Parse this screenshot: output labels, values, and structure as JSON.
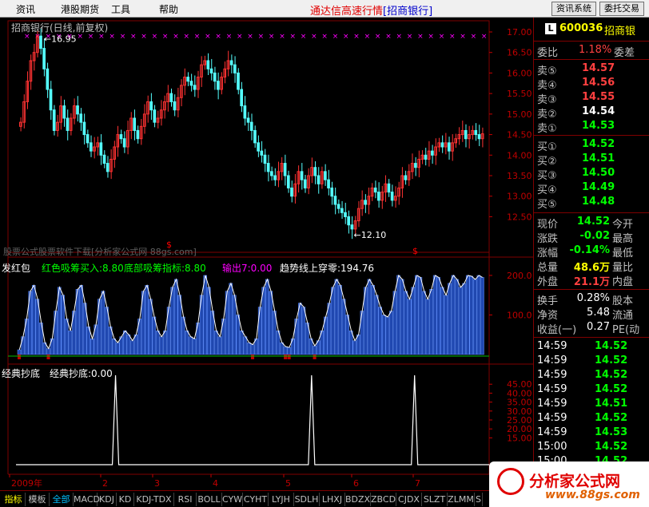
{
  "menu": {
    "items": [
      "资讯",
      "港股期货",
      "工具",
      "帮助"
    ],
    "title": "通达信高速行情",
    "title_tag": "[招商银行]",
    "btn_news": "资讯系统",
    "btn_trade": "委托交易"
  },
  "chart": {
    "title": "招商银行(日线,前复权)",
    "high_label": "16.95",
    "low_label": "12.10",
    "price_axis": [
      "17.00",
      "16.50",
      "16.00",
      "15.50",
      "15.00",
      "14.50",
      "14.00",
      "13.50",
      "13.00",
      "12.50"
    ],
    "watermark": "股票公式股票软件下载[分析家公式网 88gs.com]",
    "sub1": {
      "name": "发红包",
      "items": [
        {
          "label": "红色吸筹买入:8.80",
          "color": "#00ff00"
        },
        {
          "label": "底部吸筹指标:8.80",
          "color": "#00ff00"
        },
        {
          "label": "输出7:0.00",
          "color": "#ff00ff"
        },
        {
          "label": "趋势线上穿零:194.76",
          "color": "#ffffff"
        }
      ],
      "axis": [
        "200.0",
        "100.0"
      ]
    },
    "sub2": {
      "name": "经典抄底",
      "item": "经典抄底:0.00",
      "axis": [
        "45.00",
        "40.00",
        "35.00",
        "30.00",
        "25.00",
        "20.00",
        "15.00"
      ]
    },
    "months": [
      "2009年",
      "2",
      "3",
      "4",
      "5",
      "6",
      "7"
    ]
  },
  "chart_data": {
    "type": "candlestick",
    "title": "招商银行(日线,前复权)",
    "ylim": [
      12.1,
      17.0
    ],
    "high": 16.95,
    "low": 12.1,
    "close_series": [
      14.8,
      15.3,
      15.8,
      16.3,
      16.5,
      16.9,
      16.6,
      16.1,
      15.6,
      15.1,
      14.6,
      14.8,
      15.2,
      14.9,
      14.6,
      14.9,
      15.2,
      15.0,
      14.8,
      14.5,
      14.3,
      14.1,
      14.2,
      14.3,
      14.0,
      13.8,
      13.6,
      13.9,
      14.2,
      14.5,
      14.4,
      14.2,
      14.6,
      14.9,
      14.6,
      14.4,
      14.7,
      15.0,
      15.3,
      15.1,
      14.8,
      14.9,
      15.1,
      15.3,
      15.5,
      15.3,
      15.1,
      15.4,
      15.7,
      15.9,
      15.8,
      15.7,
      15.6,
      15.9,
      16.2,
      16.3,
      16.1,
      16.0,
      15.8,
      15.6,
      15.9,
      16.1,
      16.3,
      16.2,
      16.0,
      15.6,
      15.2,
      14.9,
      14.8,
      14.6,
      14.3,
      14.1,
      14.0,
      13.8,
      13.6,
      13.5,
      13.4,
      13.6,
      13.8,
      13.5,
      13.2,
      13.0,
      13.3,
      13.6,
      13.4,
      13.2,
      13.5,
      13.7,
      13.5,
      13.3,
      13.6,
      13.4,
      13.2,
      13.0,
      12.8,
      12.7,
      12.6,
      12.5,
      12.3,
      12.2,
      12.4,
      12.7,
      12.9,
      12.8,
      13.0,
      13.2,
      13.1,
      12.9,
      13.1,
      13.3,
      13.1,
      12.9,
      13.0,
      13.2,
      13.5,
      13.4,
      13.6,
      13.8,
      13.7,
      13.9,
      14.0,
      13.9,
      14.1,
      14.0,
      14.2,
      14.3,
      14.2,
      14.3,
      14.1,
      14.3,
      14.4,
      14.5,
      14.6,
      14.4,
      14.5,
      14.6,
      14.5,
      14.4,
      14.52
    ],
    "sub1_series": [
      12,
      45,
      90,
      160,
      175,
      140,
      80,
      30,
      15,
      40,
      110,
      170,
      150,
      90,
      60,
      110,
      165,
      175,
      130,
      70,
      40,
      75,
      140,
      160,
      120,
      70,
      40,
      30,
      45,
      60,
      50,
      35,
      50,
      90,
      160,
      175,
      140,
      95,
      60,
      45,
      60,
      120,
      170,
      190,
      150,
      95,
      60,
      45,
      40,
      80,
      150,
      200,
      170,
      110,
      60,
      45,
      90,
      160,
      180,
      150,
      100,
      60,
      45,
      30,
      25,
      40,
      120,
      170,
      190,
      160,
      110,
      60,
      30,
      20,
      18,
      40,
      90,
      130,
      120,
      80,
      40,
      22,
      35,
      60,
      95,
      130,
      170,
      190,
      175,
      140,
      100,
      60,
      35,
      50,
      110,
      170,
      190,
      175,
      150,
      120,
      100,
      95,
      110,
      160,
      200,
      190,
      160,
      140,
      170,
      200,
      195,
      160,
      140,
      165,
      200,
      195,
      170,
      150,
      180,
      200,
      190,
      170,
      180,
      200,
      198,
      190,
      200,
      195
    ],
    "sub2_spikes": [
      {
        "index": 29,
        "value": 50
      },
      {
        "index": 88,
        "value": 50
      },
      {
        "index": 119,
        "value": 50
      }
    ]
  },
  "quote": {
    "code": "600036",
    "name": "招商银",
    "weibi_label": "委比",
    "weibi": "1.18%",
    "weicha_label": "委差",
    "sell": [
      {
        "label": "卖⑤",
        "price": "14.57"
      },
      {
        "label": "卖④",
        "price": "14.56"
      },
      {
        "label": "卖③",
        "price": "14.55"
      },
      {
        "label": "卖②",
        "price": "14.54"
      },
      {
        "label": "卖①",
        "price": "14.53"
      }
    ],
    "buy": [
      {
        "label": "买①",
        "price": "14.52"
      },
      {
        "label": "买②",
        "price": "14.51"
      },
      {
        "label": "买③",
        "price": "14.50"
      },
      {
        "label": "买④",
        "price": "14.49"
      },
      {
        "label": "买⑤",
        "price": "14.48"
      }
    ],
    "stats": [
      {
        "l": "现价",
        "v": "14.52",
        "r": "今开",
        "c": "#00ff00"
      },
      {
        "l": "涨跌",
        "v": "-0.02",
        "r": "最高",
        "c": "#00ff00"
      },
      {
        "l": "涨幅",
        "v": "-0.14%",
        "r": "最低",
        "c": "#00ff00"
      },
      {
        "l": "总量",
        "v": "48.6万",
        "r": "量比",
        "c": "#ffff00"
      },
      {
        "l": "外盘",
        "v": "21.1万",
        "r": "内盘",
        "c": "#ff4040"
      }
    ],
    "stats2": [
      {
        "l": "换手",
        "v": "0.28%",
        "r": "股本"
      },
      {
        "l": "净资",
        "v": "5.48",
        "r": "流通"
      },
      {
        "l": "收益(一)",
        "v": "0.27",
        "r": "PE(动"
      }
    ],
    "ticks": [
      {
        "t": "14:59",
        "p": "14.52"
      },
      {
        "t": "14:59",
        "p": "14.52"
      },
      {
        "t": "14:59",
        "p": "14.52"
      },
      {
        "t": "14:59",
        "p": "14.52"
      },
      {
        "t": "14:59",
        "p": "14.51"
      },
      {
        "t": "14:59",
        "p": "14.52"
      },
      {
        "t": "14:59",
        "p": "14.53"
      },
      {
        "t": "15:00",
        "p": "14.52"
      },
      {
        "t": "15:00",
        "p": "14.52"
      }
    ]
  },
  "tabs": [
    "指标",
    "模板",
    "全部",
    "MACD",
    "KDJ",
    "KD",
    "KDJ-TDX",
    "RSI",
    "BOLL",
    "CYW",
    "CYHT",
    "LYJH",
    "SDLH",
    "LHXJ",
    "BDZX",
    "ZBCD",
    "CJDX",
    "SLZT",
    "ZLMM",
    "S"
  ],
  "logo": {
    "text": "分析家公式网",
    "url": "www.88gs.com"
  }
}
